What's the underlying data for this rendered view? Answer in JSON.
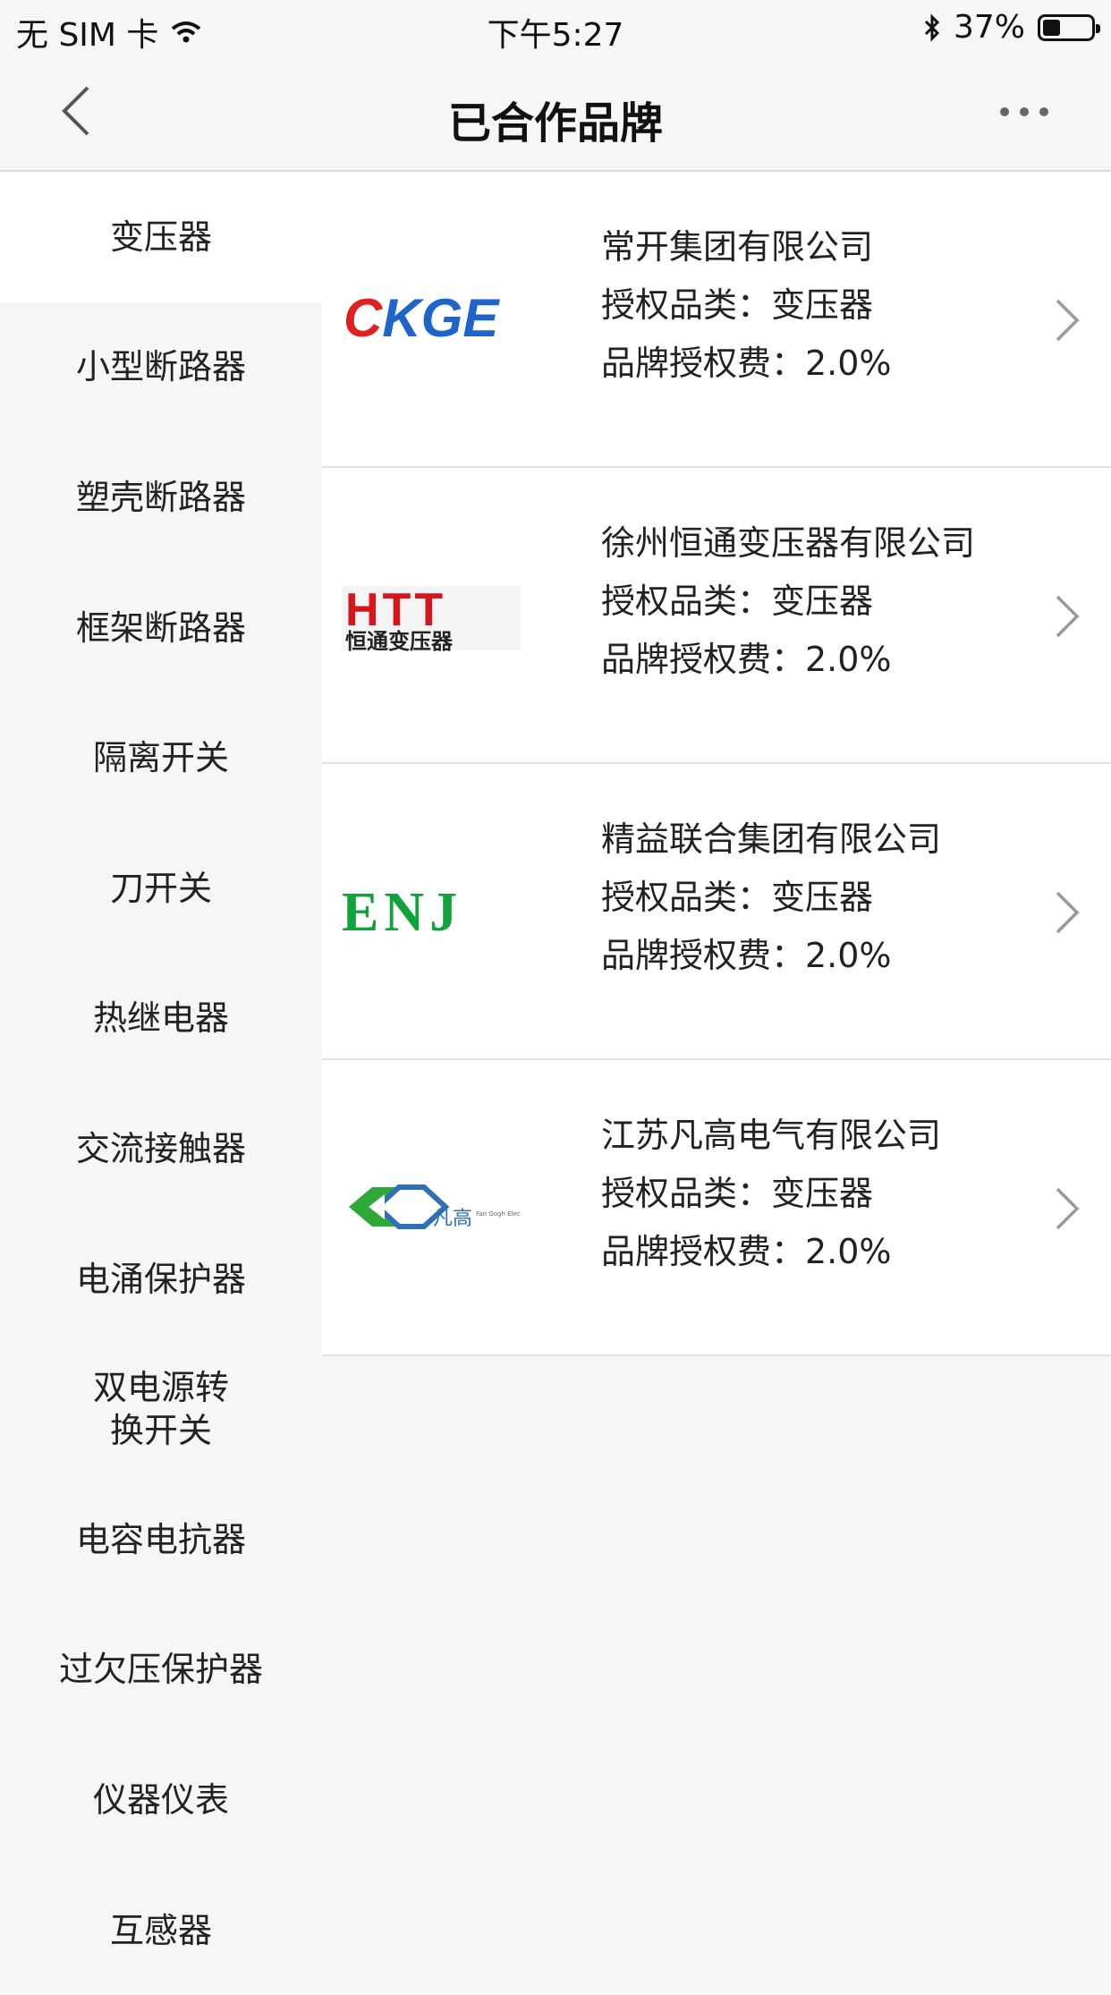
{
  "status_bar": {
    "carrier": "无 SIM 卡",
    "time": "下午5:27",
    "battery": "37%",
    "battery_level": 0.37
  },
  "nav": {
    "title": "已合作品牌",
    "back_icon": "chevron-left-icon",
    "more_icon": "more-horizontal-icon"
  },
  "sidebar": {
    "active_index": 0,
    "items": [
      {
        "label": "变压器"
      },
      {
        "label": "小型断路器"
      },
      {
        "label": "塑壳断路器"
      },
      {
        "label": "框架断路器"
      },
      {
        "label": "隔离开关"
      },
      {
        "label": "刀开关"
      },
      {
        "label": "热继电器"
      },
      {
        "label": "交流接触器"
      },
      {
        "label": "电涌保护器"
      },
      {
        "label": "双电源转换开关"
      },
      {
        "label": "电容电抗器"
      },
      {
        "label": "过欠压保护器"
      },
      {
        "label": "仪器仪表"
      },
      {
        "label": "互感器"
      }
    ]
  },
  "brands": [
    {
      "company": "常开集团有限公司",
      "category": "授权品类：变压器",
      "fee": "品牌授权费：2.0%",
      "logo_text": "CKGE"
    },
    {
      "company": "徐州恒通变压器有限公司",
      "category": "授权品类：变压器",
      "fee": "品牌授权费：2.0%",
      "logo_text": "HTT",
      "logo_subtext": "恒通变压器"
    },
    {
      "company": "精益联合集团有限公司",
      "category": "授权品类：变压器",
      "fee": "品牌授权费：2.0%",
      "logo_text": "ENJ"
    },
    {
      "company": "江苏凡高电气有限公司",
      "category": "授权品类：变压器",
      "fee": "品牌授权费：2.0%",
      "logo_text": "凡高",
      "logo_subtext": "Fan Gogh Electric"
    }
  ],
  "colors": {
    "ckge_red": "#e02020",
    "ckge_blue": "#1f64c8",
    "htt_red": "#d8141c",
    "enj_green": "#12a23c",
    "fangao_green": "#2fa83a",
    "fangao_blue": "#2f6fb6"
  }
}
